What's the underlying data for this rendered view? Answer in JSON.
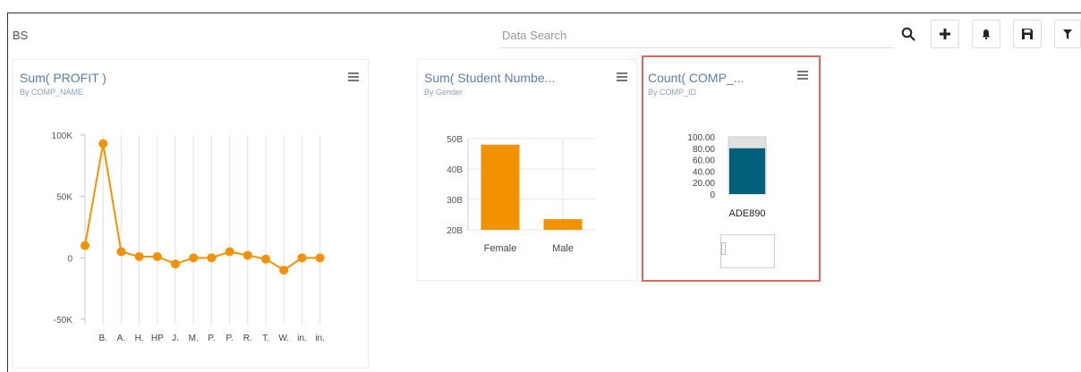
{
  "app": {
    "title": "BS"
  },
  "search": {
    "placeholder": "Data Search"
  },
  "toolbar": {
    "icons": [
      "search-icon",
      "plus-icon",
      "bell-icon",
      "save-icon",
      "filter-icon"
    ]
  },
  "tiles": [
    {
      "title": "Sum( PROFIT )",
      "subtitle": "By COMP_NAME"
    },
    {
      "title": "Sum( Student Numbe...",
      "subtitle": "By Gender"
    },
    {
      "title": "Count( COMP_...",
      "subtitle": "By COMP_ID"
    }
  ],
  "colors": {
    "line": "#f39200",
    "bar": "#f39200",
    "gauge": "#005f7a",
    "gauge_bg": "#e0e0e0",
    "title": "#5a7fa8",
    "selected_border": "#e06666"
  },
  "chart_data": [
    {
      "type": "line",
      "title": "Sum( PROFIT )",
      "subtitle": "By COMP_NAME",
      "categories": [
        "",
        "B.",
        "A.",
        "H.",
        "HP",
        "J.",
        "M.",
        "P.",
        "P.",
        "R.",
        "T.",
        "W.",
        "in.",
        "in."
      ],
      "values": [
        10000,
        93000,
        5000,
        1000,
        1000,
        -5000,
        0,
        0,
        5000,
        2000,
        -1000,
        -10000,
        0,
        0
      ],
      "ylim": [
        -50000,
        100000
      ],
      "yticks": [
        100000,
        50000,
        0,
        -50000
      ],
      "ytick_labels": [
        "100K",
        "50K",
        "0",
        "-50K"
      ],
      "grid": true
    },
    {
      "type": "bar",
      "title": "Sum( Student Numbe...",
      "subtitle": "By Gender",
      "categories": [
        "Female",
        "Male"
      ],
      "values": [
        48000000000,
        23500000000
      ],
      "ylim": [
        20000000000,
        50000000000
      ],
      "yticks": [
        20000000000,
        30000000000,
        40000000000,
        50000000000
      ],
      "ytick_labels": [
        "20B",
        "30B",
        "40B",
        "50B"
      ],
      "grid": true
    },
    {
      "type": "bar",
      "title": "Count( COMP_...",
      "subtitle": "By COMP_ID",
      "categories": [
        "ADE890"
      ],
      "values": [
        80
      ],
      "ylim": [
        0,
        100
      ],
      "yticks": [
        0,
        20,
        40,
        60,
        80,
        100
      ],
      "ytick_labels": [
        "0",
        "20.00",
        "40.00",
        "60.00",
        "80.00",
        "100.00"
      ]
    }
  ]
}
